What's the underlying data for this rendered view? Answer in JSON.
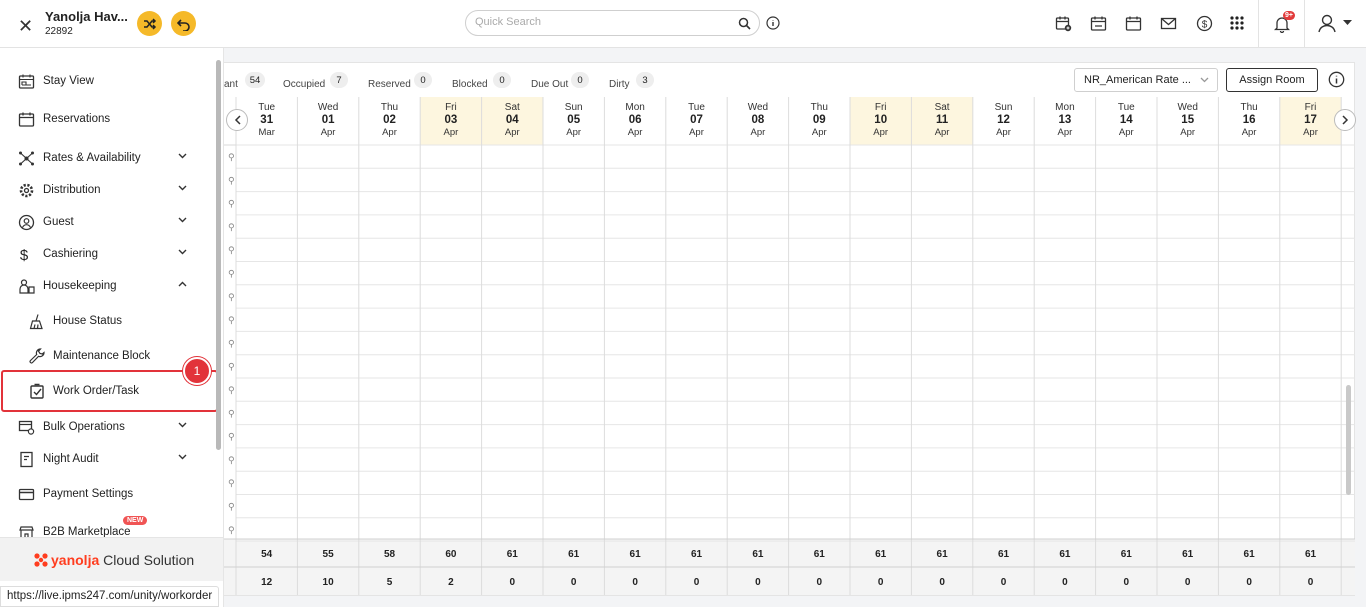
{
  "header": {
    "hotel_name": "Yanolja Hav...",
    "hotel_id": "22892",
    "search_placeholder": "Quick Search",
    "notification_count": "9+"
  },
  "sidebar": {
    "items": [
      {
        "label": "Stay View",
        "icon": "calendar-bed-icon"
      },
      {
        "label": "Reservations",
        "icon": "calendar-icon"
      },
      {
        "label": "Rates & Availability",
        "icon": "network-icon"
      },
      {
        "label": "Distribution",
        "icon": "gear-icon"
      },
      {
        "label": "Guest",
        "icon": "guest-icon"
      },
      {
        "label": "Cashiering",
        "icon": "dollar-icon"
      },
      {
        "label": "Housekeeping",
        "icon": "housekeeping-icon"
      },
      {
        "label": "House Status",
        "icon": "broom-icon"
      },
      {
        "label": "Maintenance Block",
        "icon": "wrench-icon"
      },
      {
        "label": "Work Order/Task",
        "icon": "checkbox-icon"
      },
      {
        "label": "Bulk Operations",
        "icon": "bulk-icon"
      },
      {
        "label": "Night Audit",
        "icon": "document-icon"
      },
      {
        "label": "Payment Settings",
        "icon": "card-icon"
      },
      {
        "label": "B2B Marketplace",
        "icon": "marketplace-icon"
      }
    ],
    "new_badge": "NEW",
    "highlight_number": "1",
    "brand_strong": "yanolja",
    "brand_rest": " Cloud Solution"
  },
  "status_url": "https://live.ipms247.com/unity/workorder",
  "stats": [
    {
      "label": "ant",
      "count": "54"
    },
    {
      "label": "Occupied",
      "count": "7"
    },
    {
      "label": "Reserved",
      "count": "0"
    },
    {
      "label": "Blocked",
      "count": "0"
    },
    {
      "label": "Due Out",
      "count": "0"
    },
    {
      "label": "Dirty",
      "count": "3"
    }
  ],
  "toolbar": {
    "rate_plan": "NR_American Rate ...",
    "assign_room": "Assign Room"
  },
  "days": [
    {
      "dow": "Tue",
      "date": "31",
      "mon": "Mar",
      "weekend": false,
      "avail": "54",
      "sold": "12"
    },
    {
      "dow": "Wed",
      "date": "01",
      "mon": "Apr",
      "weekend": false,
      "avail": "55",
      "sold": "10"
    },
    {
      "dow": "Thu",
      "date": "02",
      "mon": "Apr",
      "weekend": false,
      "avail": "58",
      "sold": "5"
    },
    {
      "dow": "Fri",
      "date": "03",
      "mon": "Apr",
      "weekend": true,
      "avail": "60",
      "sold": "2"
    },
    {
      "dow": "Sat",
      "date": "04",
      "mon": "Apr",
      "weekend": true,
      "avail": "61",
      "sold": "0"
    },
    {
      "dow": "Sun",
      "date": "05",
      "mon": "Apr",
      "weekend": false,
      "avail": "61",
      "sold": "0"
    },
    {
      "dow": "Mon",
      "date": "06",
      "mon": "Apr",
      "weekend": false,
      "avail": "61",
      "sold": "0"
    },
    {
      "dow": "Tue",
      "date": "07",
      "mon": "Apr",
      "weekend": false,
      "avail": "61",
      "sold": "0"
    },
    {
      "dow": "Wed",
      "date": "08",
      "mon": "Apr",
      "weekend": false,
      "avail": "61",
      "sold": "0"
    },
    {
      "dow": "Thu",
      "date": "09",
      "mon": "Apr",
      "weekend": false,
      "avail": "61",
      "sold": "0"
    },
    {
      "dow": "Fri",
      "date": "10",
      "mon": "Apr",
      "weekend": true,
      "avail": "61",
      "sold": "0"
    },
    {
      "dow": "Sat",
      "date": "11",
      "mon": "Apr",
      "weekend": true,
      "avail": "61",
      "sold": "0"
    },
    {
      "dow": "Sun",
      "date": "12",
      "mon": "Apr",
      "weekend": false,
      "avail": "61",
      "sold": "0"
    },
    {
      "dow": "Mon",
      "date": "13",
      "mon": "Apr",
      "weekend": false,
      "avail": "61",
      "sold": "0"
    },
    {
      "dow": "Tue",
      "date": "14",
      "mon": "Apr",
      "weekend": false,
      "avail": "61",
      "sold": "0"
    },
    {
      "dow": "Wed",
      "date": "15",
      "mon": "Apr",
      "weekend": false,
      "avail": "61",
      "sold": "0"
    },
    {
      "dow": "Thu",
      "date": "16",
      "mon": "Apr",
      "weekend": false,
      "avail": "61",
      "sold": "0"
    },
    {
      "dow": "Fri",
      "date": "17",
      "mon": "Apr",
      "weekend": true,
      "avail": "61",
      "sold": "0"
    }
  ],
  "colors": {
    "accent_yellow": "#f5b929",
    "highlight_red": "#e2333a",
    "weekend_bg": "#fdf6df",
    "brand_orange": "#ff3d1f"
  }
}
